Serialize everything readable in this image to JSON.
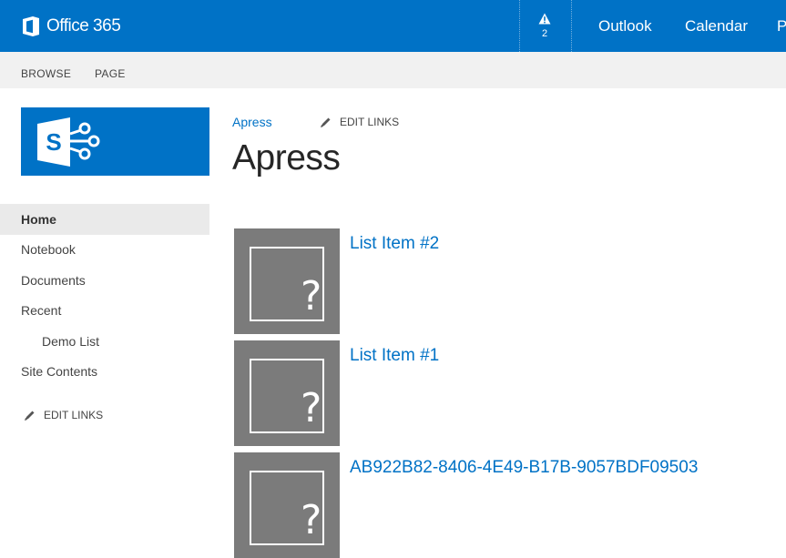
{
  "suite_bar": {
    "brand": "Office 365",
    "brand_color": "#0072c6",
    "alert_count": "2",
    "links": [
      "Outlook",
      "Calendar",
      "P"
    ]
  },
  "ribbon": {
    "tabs": [
      "BROWSE",
      "PAGE"
    ]
  },
  "site_logo": {
    "letter": "S",
    "icon": "sharepoint-logo-icon"
  },
  "left_nav": {
    "items": [
      {
        "label": "Home",
        "selected": true
      },
      {
        "label": "Notebook"
      },
      {
        "label": "Documents"
      },
      {
        "label": "Recent"
      },
      {
        "label": "Demo List"
      },
      {
        "label": "Site Contents"
      }
    ],
    "edit_links": "EDIT LINKS"
  },
  "main": {
    "breadcrumb": "Apress",
    "edit_links": "EDIT LINKS",
    "title": "Apress",
    "items": [
      {
        "title": "List Item #2",
        "thumb_glyph": "?"
      },
      {
        "title": "List Item #1",
        "thumb_glyph": "?"
      },
      {
        "title": "AB922B82-8406-4E49-B17B-9057BDF09503",
        "thumb_glyph": "?"
      }
    ]
  }
}
